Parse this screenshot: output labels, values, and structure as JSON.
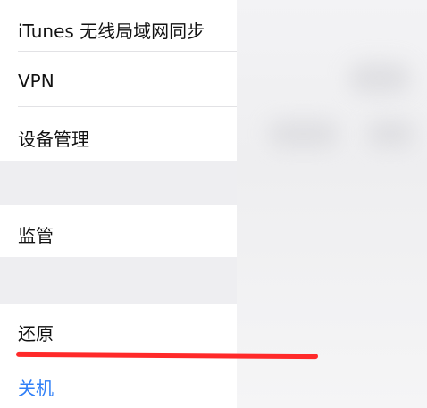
{
  "settings": {
    "items": [
      {
        "label": "iTunes 无线局域网同步"
      },
      {
        "label": "VPN"
      },
      {
        "label": "设备管理"
      },
      {
        "label": "监管"
      },
      {
        "label": "还原"
      },
      {
        "label": "关机"
      }
    ]
  },
  "colors": {
    "link_blue": "#2f7ff7",
    "annotation_red": "#ff2a2a"
  }
}
